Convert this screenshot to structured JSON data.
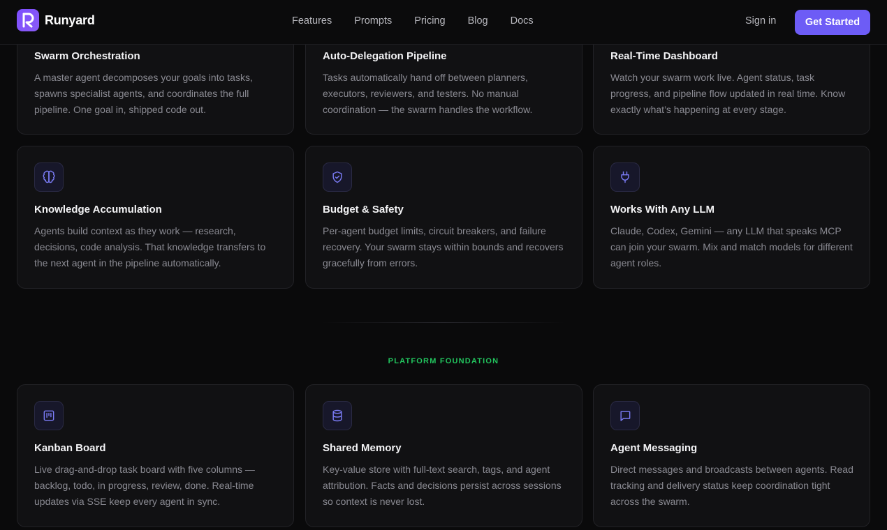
{
  "nav": {
    "brand": "Runyard",
    "links": [
      "Features",
      "Prompts",
      "Pricing",
      "Blog",
      "Docs"
    ],
    "sign_in": "Sign in",
    "cta": "Get Started"
  },
  "colors": {
    "accent": "#6d5cf6",
    "section_label": "#22c55e",
    "background": "#0a0a0b",
    "card": "#111113"
  },
  "features_top": [
    {
      "title": "Swarm Orchestration",
      "description": "A master agent decomposes your goals into tasks, spawns specialist agents, and coordinates the full pipeline. One goal in, shipped code out."
    },
    {
      "title": "Auto-Delegation Pipeline",
      "description": "Tasks automatically hand off between planners, executors, reviewers, and testers. No manual coordination — the swarm handles the workflow."
    },
    {
      "title": "Real-Time Dashboard",
      "description": "Watch your swarm work live. Agent status, task progress, and pipeline flow updated in real time. Know exactly what’s happening at every stage."
    }
  ],
  "features_mid": [
    {
      "icon": "brain-icon",
      "title": "Knowledge Accumulation",
      "description": "Agents build context as they work — research, decisions, code analysis. That knowledge transfers to the next agent in the pipeline automatically."
    },
    {
      "icon": "shield-icon",
      "title": "Budget & Safety",
      "description": "Per-agent budget limits, circuit breakers, and failure recovery. Your swarm stays within bounds and recovers gracefully from errors."
    },
    {
      "icon": "plug-icon",
      "title": "Works With Any LLM",
      "description": "Claude, Codex, Gemini — any LLM that speaks MCP can join your swarm. Mix and match models for different agent roles."
    }
  ],
  "section_label": "PLATFORM FOUNDATION",
  "platform": [
    {
      "icon": "kanban-icon",
      "title": "Kanban Board",
      "description": "Live drag-and-drop task board with five columns — backlog, todo, in progress, review, done. Real-time updates via SSE keep every agent in sync."
    },
    {
      "icon": "database-icon",
      "title": "Shared Memory",
      "description": "Key-value store with full-text search, tags, and agent attribution. Facts and decisions persist across sessions so context is never lost."
    },
    {
      "icon": "message-icon",
      "title": "Agent Messaging",
      "description": "Direct messages and broadcasts between agents. Read tracking and delivery status keep coordination tight across the swarm."
    }
  ]
}
